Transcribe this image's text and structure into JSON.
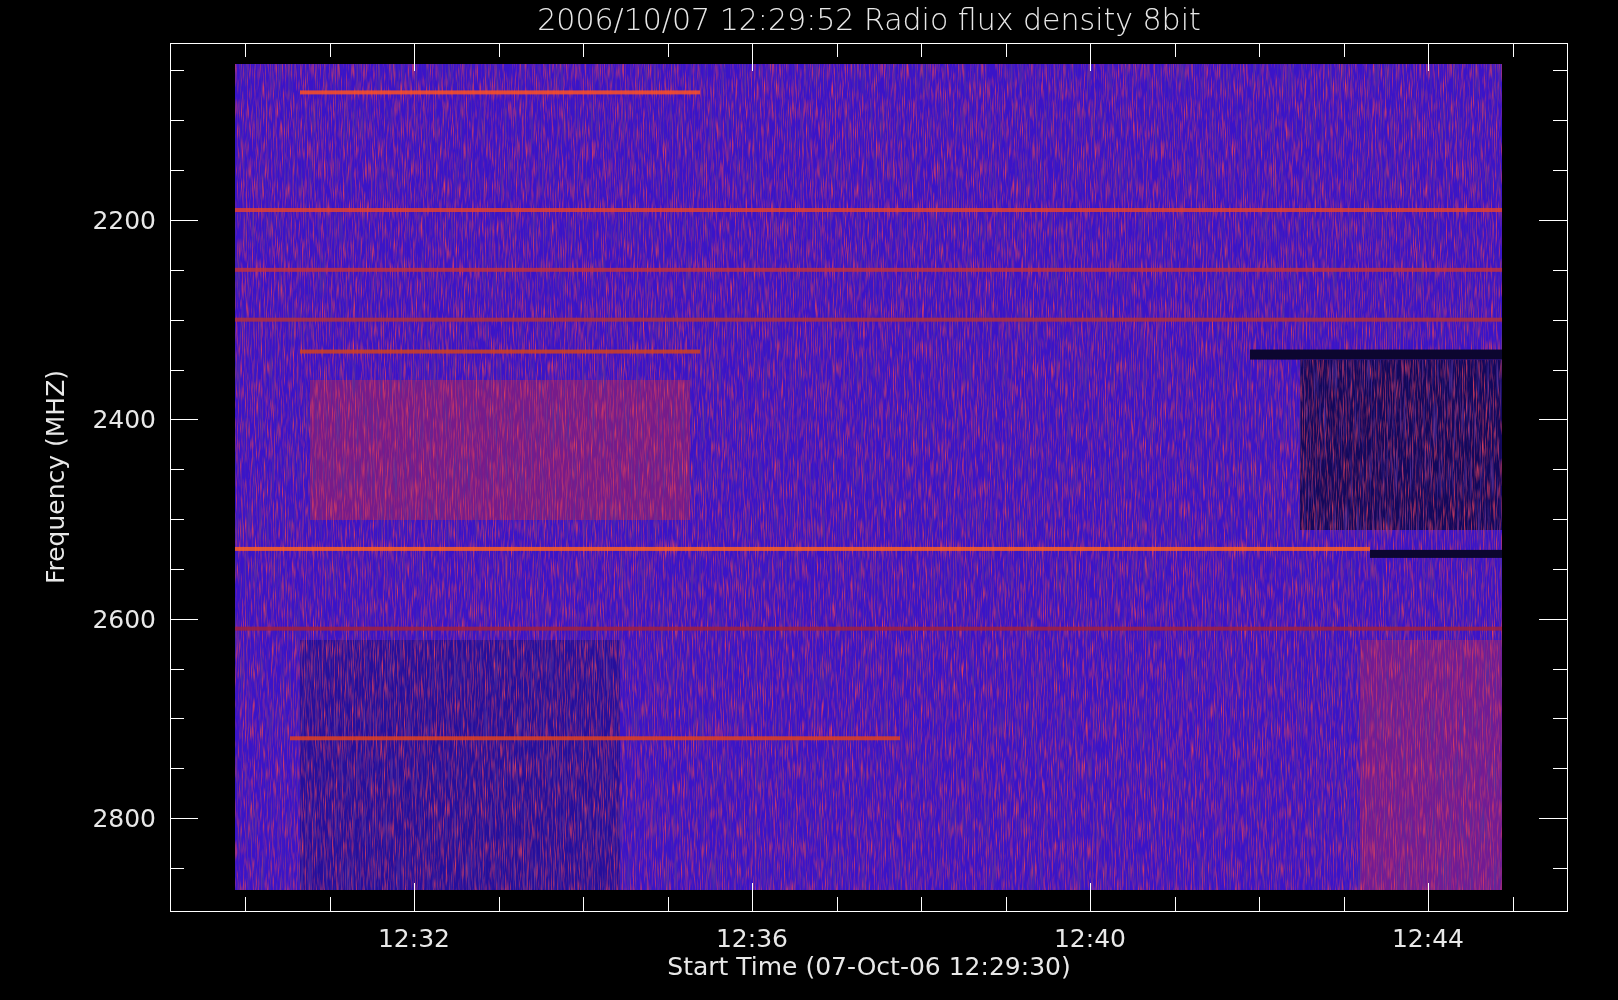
{
  "plot": {
    "title": "2006/10/07 12:29:52 Radio flux density 8bit",
    "xlabel": "Start Time (07-Oct-06 12:29:30)",
    "ylabel": "Frequency (MHZ)",
    "xticks": [
      "12:32",
      "12:36",
      "12:40",
      "12:44"
    ],
    "yticks": [
      "2200",
      "2400",
      "2600",
      "2800"
    ]
  }
}
